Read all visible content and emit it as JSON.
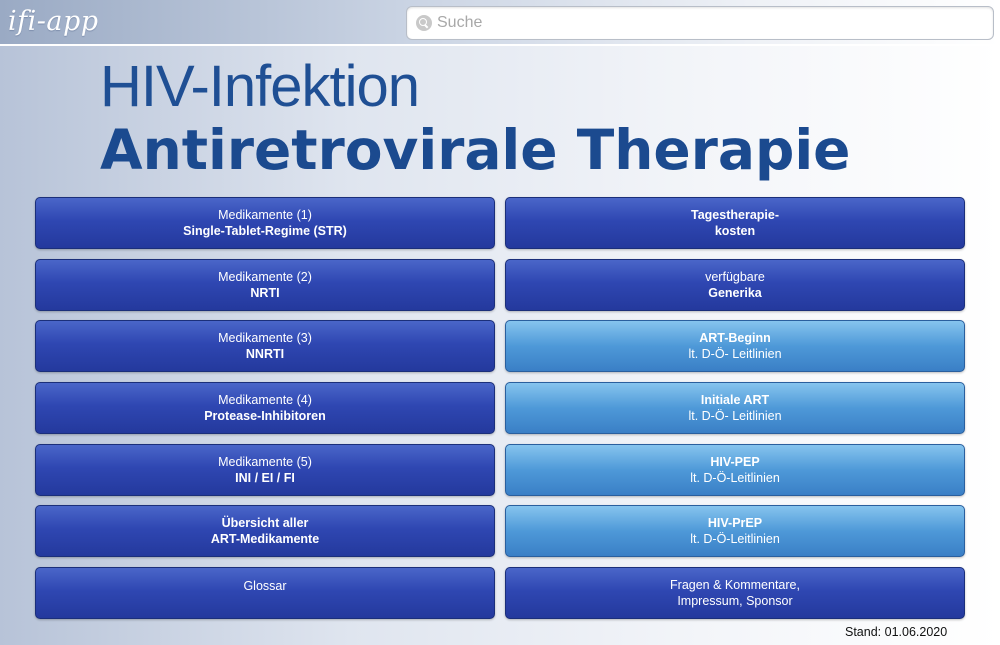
{
  "header": {
    "logo": "ifi-app",
    "search_placeholder": "Suche"
  },
  "title": {
    "line1": "HIV-Infektion",
    "line2": "Antiretrovirale Therapie"
  },
  "left_buttons": [
    {
      "line1": "Medikamente (1)",
      "line2": "Single-Tablet-Regime (STR)"
    },
    {
      "line1": "Medikamente (2)",
      "line2": "NRTI"
    },
    {
      "line1": "Medikamente (3)",
      "line2": "NNRTI"
    },
    {
      "line1": "Medikamente (4)",
      "line2": "Protease-Inhibitoren"
    },
    {
      "line1": "Medikamente (5)",
      "line2": "INI / EI / FI"
    },
    {
      "line1": "Übersicht aller",
      "line2": "ART-Medikamente"
    },
    {
      "line1": "Glossar",
      "line2": ""
    }
  ],
  "right_buttons": [
    {
      "line1": "Tagestherapie-",
      "line2": "kosten"
    },
    {
      "line1": "verfügbare",
      "line2": "Generika"
    },
    {
      "line1": "ART-Beginn",
      "line2": "lt. D-Ö- Leitlinien"
    },
    {
      "line1": "Initiale ART",
      "line2": "lt. D-Ö- Leitlinien"
    },
    {
      "line1": "HIV-PEP",
      "line2": "lt. D-Ö-Leitlinien"
    },
    {
      "line1": "HIV-PrEP",
      "line2": "lt. D-Ö-Leitlinien"
    },
    {
      "line1": "Fragen & Kommentare,",
      "line2": "Impressum, Sponsor"
    }
  ],
  "footer": {
    "stand": "Stand: 01.06.2020"
  },
  "colors": {
    "title": "#1f4f94",
    "button_dark": "#2f47b2",
    "button_light": "#4e99d8"
  }
}
